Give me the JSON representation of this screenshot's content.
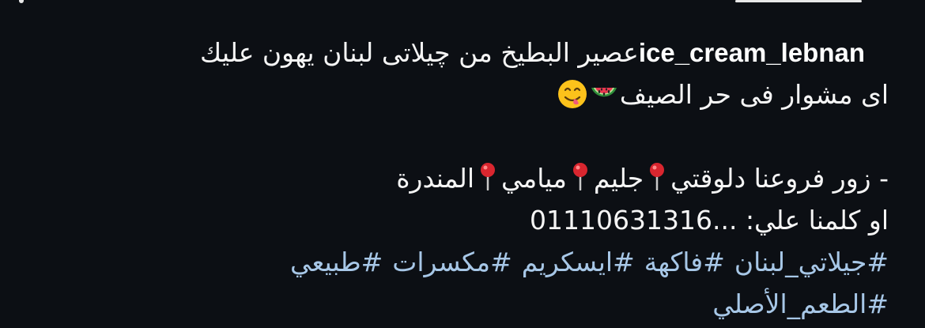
{
  "post": {
    "username": "ice_cream_lebnan",
    "line1": "عصير البطيخ من چيلاتى لبنان يهون عليك",
    "line2": "اى مشوار فى حر الصيف",
    "line2_emojis": [
      "watermelon-icon",
      "yum-face-icon"
    ],
    "branches_prefix": "- زور فروعنا دلوقتي",
    "branches": [
      "جليم",
      "ميامي",
      "المندرة"
    ],
    "branch_icon": "round-pushpin-icon",
    "contact_label": "او كلمنا علي:",
    "phone": "01110631316...",
    "hashtags": [
      "#جيلاتي_لبنان",
      "#فاكهة",
      "#ايسكريم",
      "#مكسرات",
      "#طبيعي",
      "#الطعم_الأصلي"
    ],
    "hashtag_color": "#a7c7e7",
    "background_color": "#0c0f14"
  }
}
